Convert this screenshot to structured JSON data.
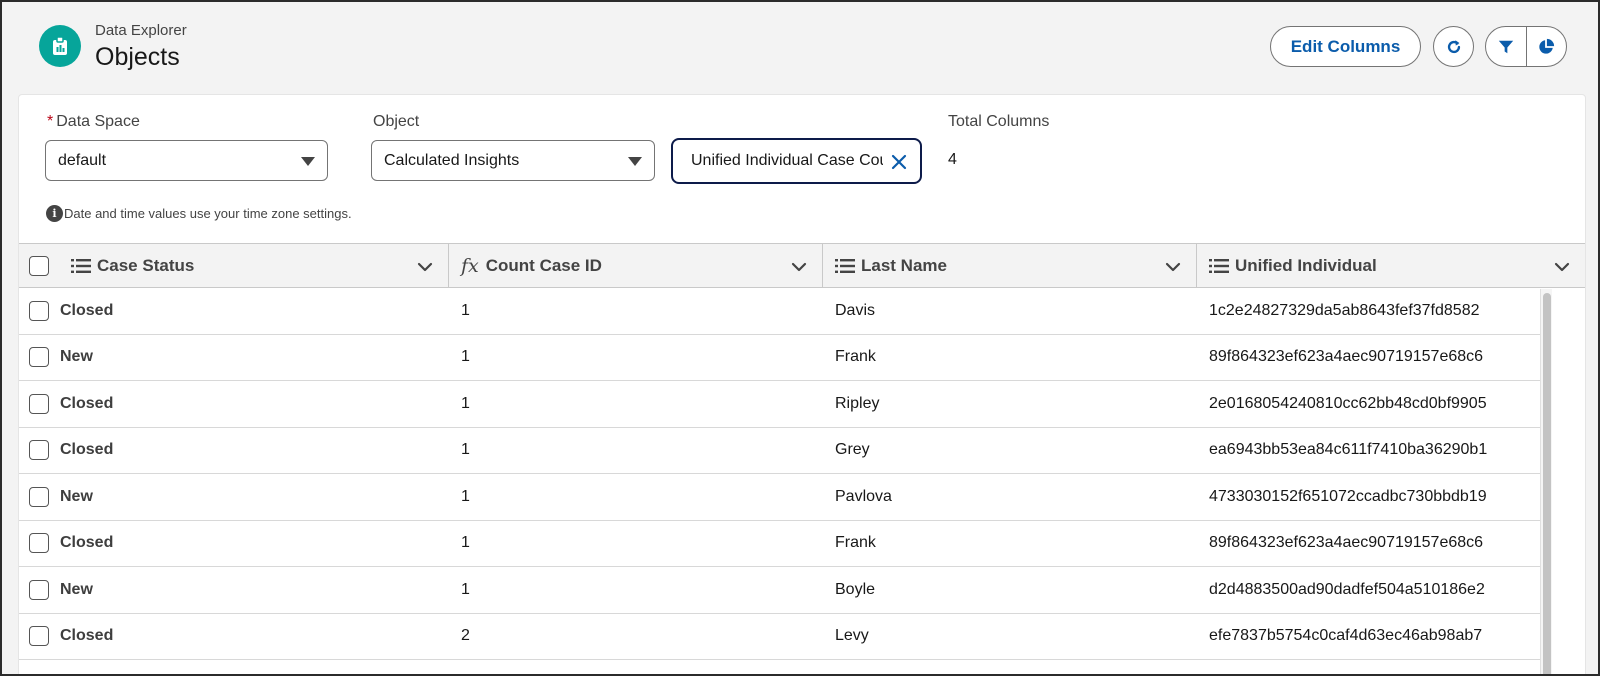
{
  "header": {
    "eyebrow": "Data Explorer",
    "title": "Objects",
    "edit_columns_label": "Edit Columns",
    "icons": [
      "data-explorer-app-icon",
      "refresh-icon",
      "filter-icon",
      "chart-icon"
    ],
    "brand_color": "#06a59a",
    "accent_color": "#0b5cab"
  },
  "filters": {
    "data_space_label": "Data Space",
    "data_space_required_mark": "*",
    "data_space_value": "default",
    "object_label": "Object",
    "object_type_value": "Calculated Insights",
    "object_name_value": "Unified Individual Case Count",
    "total_columns_label": "Total Columns",
    "total_columns_value": "4",
    "timezone_note": "Date and time values use your time zone settings.",
    "info_glyph": "i"
  },
  "table": {
    "columns": [
      {
        "label": "Case Status",
        "icon": "list-icon"
      },
      {
        "label": "Count Case ID",
        "icon": "formula-fx-icon",
        "icon_glyph": "fx"
      },
      {
        "label": "Last Name",
        "icon": "list-icon"
      },
      {
        "label": "Unified Individual",
        "icon": "list-icon"
      }
    ],
    "rows": [
      {
        "status": "Closed",
        "count": "1",
        "last_name": "Davis",
        "unified": "1c2e24827329da5ab8643fef37fd8582"
      },
      {
        "status": "New",
        "count": "1",
        "last_name": "Frank",
        "unified": "89f864323ef623a4aec90719157e68c6"
      },
      {
        "status": "Closed",
        "count": "1",
        "last_name": "Ripley",
        "unified": "2e0168054240810cc62bb48cd0bf9905"
      },
      {
        "status": "Closed",
        "count": "1",
        "last_name": "Grey",
        "unified": "ea6943bb53ea84c611f7410ba36290b1"
      },
      {
        "status": "New",
        "count": "1",
        "last_name": "Pavlova",
        "unified": "4733030152f651072ccadbc730bbdb19"
      },
      {
        "status": "Closed",
        "count": "1",
        "last_name": "Frank",
        "unified": "89f864323ef623a4aec90719157e68c6"
      },
      {
        "status": "New",
        "count": "1",
        "last_name": "Boyle",
        "unified": "d2d4883500ad90dadfef504a510186e2"
      },
      {
        "status": "Closed",
        "count": "2",
        "last_name": "Levy",
        "unified": "efe7837b5754c0caf4d63ec46ab98ab7"
      }
    ]
  }
}
